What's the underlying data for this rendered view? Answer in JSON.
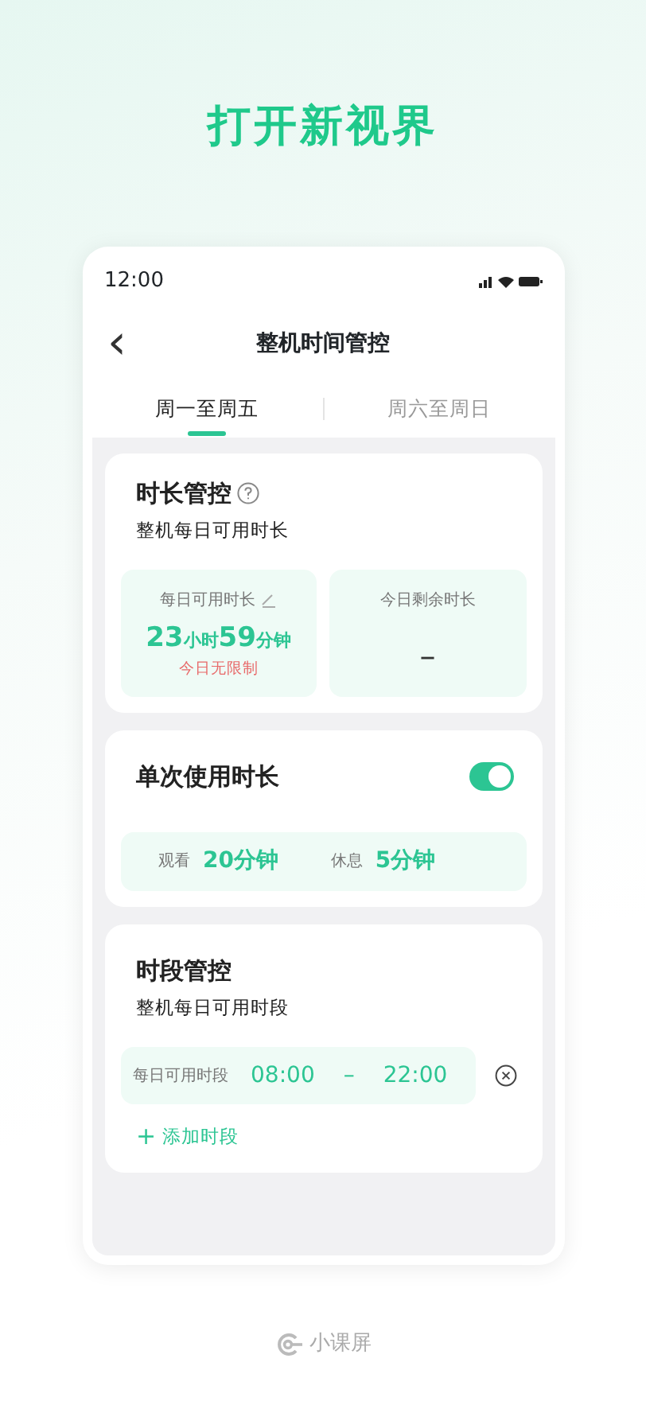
{
  "headline": "打开新视界",
  "status_bar": {
    "time": "12:00"
  },
  "header": {
    "back": "‹",
    "title": "整机时间管控"
  },
  "tabs": [
    {
      "label": "周一至周五",
      "selected": true
    },
    {
      "label": "周六至周日",
      "selected": false
    }
  ],
  "duration_card": {
    "title": "时长管控",
    "subtitle": "整机每日可用时长",
    "daily": {
      "label": "每日可用时长",
      "parts": [
        {
          "kind": "number",
          "text": "23"
        },
        {
          "kind": "unit",
          "text": "小时"
        },
        {
          "kind": "number",
          "text": "59"
        },
        {
          "kind": "unit",
          "text": "分钟"
        }
      ],
      "note": "今日无限制"
    },
    "remaining": {
      "label": "今日剩余时长",
      "value": "–"
    }
  },
  "single_card": {
    "title": "单次使用时长",
    "on": true,
    "items": [
      {
        "label": "观看",
        "value": "20分钟"
      },
      {
        "label": "休息",
        "value": "5分钟"
      }
    ]
  },
  "period_card": {
    "title": "时段管控",
    "subtitle": "整机每日可用时段",
    "periods": [
      {
        "label": "每日可用时段",
        "start": "08:00",
        "separator": "–",
        "end": "22:00"
      }
    ],
    "add": {
      "icon": "+",
      "label": "添加时段"
    }
  },
  "brand": "小课屏"
}
